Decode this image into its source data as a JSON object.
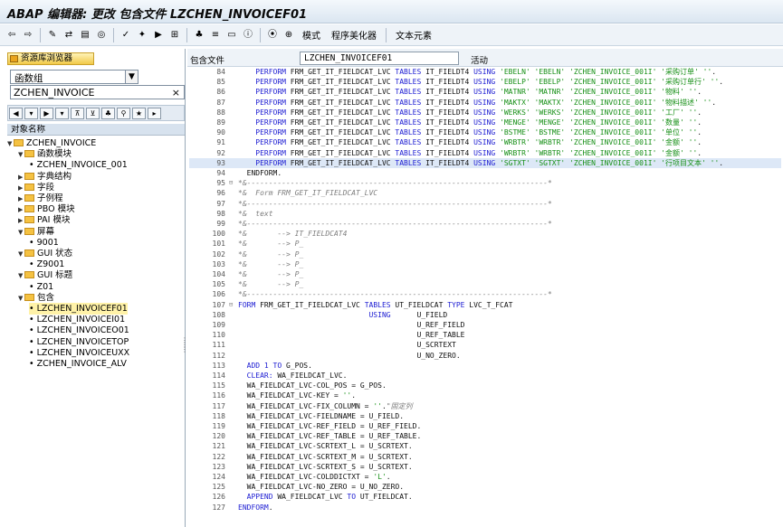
{
  "window": {
    "title": "ABAP 编辑器: 更改 包含文件 LZCHEN_INVOICEF01"
  },
  "toolbar": {
    "icons": [
      "back-icon",
      "forward-icon",
      "change-display-icon",
      "switch-icon",
      "object-list-icon",
      "display-object-icon",
      "check-icon",
      "activate-icon",
      "test-icon",
      "where-used-icon",
      "pretty-print-icon",
      "help-icon",
      "window-icon",
      "info-icon",
      "breakpoint-icon",
      "session-breakpoint-icon"
    ],
    "pattern_label": "模式",
    "pretty_printer_label": "程序美化器",
    "text_elements_label": "文本元素"
  },
  "left_panel": {
    "repo_browser_label": "资源库浏览器",
    "object_type": "函数组",
    "object_name": "ZCHEN_INVOICE",
    "object_name_header": "对象名称",
    "tree": [
      {
        "label": "ZCHEN_INVOICE",
        "level": 0,
        "type": "folder",
        "open": true
      },
      {
        "label": "函数模块",
        "level": 1,
        "type": "folder",
        "open": true
      },
      {
        "label": "ZCHEN_INVOICE_001",
        "level": 2,
        "type": "leaf"
      },
      {
        "label": "字典结构",
        "level": 1,
        "type": "folder",
        "open": false
      },
      {
        "label": "字段",
        "level": 1,
        "type": "folder",
        "open": false
      },
      {
        "label": "子例程",
        "level": 1,
        "type": "folder",
        "open": false
      },
      {
        "label": "PBO 模块",
        "level": 1,
        "type": "folder",
        "open": false
      },
      {
        "label": "PAI 模块",
        "level": 1,
        "type": "folder",
        "open": false
      },
      {
        "label": "屏幕",
        "level": 1,
        "type": "folder",
        "open": true
      },
      {
        "label": "9001",
        "level": 2,
        "type": "leaf"
      },
      {
        "label": "GUI 状态",
        "level": 1,
        "type": "folder",
        "open": true
      },
      {
        "label": "Z9001",
        "level": 2,
        "type": "leaf"
      },
      {
        "label": "GUI 标题",
        "level": 1,
        "type": "folder",
        "open": true
      },
      {
        "label": "Z01",
        "level": 2,
        "type": "leaf"
      },
      {
        "label": "包含",
        "level": 1,
        "type": "folder",
        "open": true
      },
      {
        "label": "LZCHEN_INVOICEF01",
        "level": 2,
        "type": "leaf",
        "selected": true
      },
      {
        "label": "LZCHEN_INVOICEI01",
        "level": 2,
        "type": "leaf"
      },
      {
        "label": "LZCHEN_INVOICEO01",
        "level": 2,
        "type": "leaf"
      },
      {
        "label": "LZCHEN_INVOICETOP",
        "level": 2,
        "type": "leaf"
      },
      {
        "label": "LZCHEN_INVOICEUXX",
        "level": 2,
        "type": "leaf"
      },
      {
        "label": "ZCHEN_INVOICE_ALV",
        "level": 2,
        "type": "leaf"
      }
    ]
  },
  "editor_header": {
    "include_label": "包含文件",
    "include_name": "LZCHEN_INVOICEF01",
    "status": "活动"
  },
  "code_lines": [
    {
      "n": "84",
      "m": "",
      "t": [
        [
          "kw",
          "    PERFORM "
        ],
        [
          "",
          "FRM_GET_IT_FIELDCAT_LVC "
        ],
        [
          "kw",
          "TABLES "
        ],
        [
          "",
          "IT_FIELDT4 "
        ],
        [
          "kw",
          "USING "
        ],
        [
          "st",
          "'EBELN' 'EBELN' 'ZCHEN_INVOICE_001I' '采购订单' ''"
        ],
        [
          "",
          "."
        ]
      ]
    },
    {
      "n": "85",
      "m": "",
      "t": [
        [
          "kw",
          "    PERFORM "
        ],
        [
          "",
          "FRM_GET_IT_FIELDCAT_LVC "
        ],
        [
          "kw",
          "TABLES "
        ],
        [
          "",
          "IT_FIELDT4 "
        ],
        [
          "kw",
          "USING "
        ],
        [
          "st",
          "'EBELP' 'EBELP' 'ZCHEN_INVOICE_001I' '采购订单行' ''"
        ],
        [
          "",
          "."
        ]
      ]
    },
    {
      "n": "86",
      "m": "",
      "t": [
        [
          "kw",
          "    PERFORM "
        ],
        [
          "",
          "FRM_GET_IT_FIELDCAT_LVC "
        ],
        [
          "kw",
          "TABLES "
        ],
        [
          "",
          "IT_FIELDT4 "
        ],
        [
          "kw",
          "USING "
        ],
        [
          "st",
          "'MATNR' 'MATNR' 'ZCHEN_INVOICE_001I' '物料' ''"
        ],
        [
          "",
          "."
        ]
      ]
    },
    {
      "n": "87",
      "m": "",
      "t": [
        [
          "kw",
          "    PERFORM "
        ],
        [
          "",
          "FRM_GET_IT_FIELDCAT_LVC "
        ],
        [
          "kw",
          "TABLES "
        ],
        [
          "",
          "IT_FIELDT4 "
        ],
        [
          "kw",
          "USING "
        ],
        [
          "st",
          "'MAKTX' 'MAKTX' 'ZCHEN_INVOICE_001I' '物料描述' ''"
        ],
        [
          "",
          "."
        ]
      ]
    },
    {
      "n": "88",
      "m": "",
      "t": [
        [
          "kw",
          "    PERFORM "
        ],
        [
          "",
          "FRM_GET_IT_FIELDCAT_LVC "
        ],
        [
          "kw",
          "TABLES "
        ],
        [
          "",
          "IT_FIELDT4 "
        ],
        [
          "kw",
          "USING "
        ],
        [
          "st",
          "'WERKS' 'WERKS' 'ZCHEN_INVOICE_001I' '工厂' ''"
        ],
        [
          "",
          "."
        ]
      ]
    },
    {
      "n": "89",
      "m": "",
      "t": [
        [
          "kw",
          "    PERFORM "
        ],
        [
          "",
          "FRM_GET_IT_FIELDCAT_LVC "
        ],
        [
          "kw",
          "TABLES "
        ],
        [
          "",
          "IT_FIELDT4 "
        ],
        [
          "kw",
          "USING "
        ],
        [
          "st",
          "'MENGE' 'MENGE' 'ZCHEN_INVOICE_001I' '数量' ''"
        ],
        [
          "",
          "."
        ]
      ]
    },
    {
      "n": "90",
      "m": "",
      "t": [
        [
          "kw",
          "    PERFORM "
        ],
        [
          "",
          "FRM_GET_IT_FIELDCAT_LVC "
        ],
        [
          "kw",
          "TABLES "
        ],
        [
          "",
          "IT_FIELDT4 "
        ],
        [
          "kw",
          "USING "
        ],
        [
          "st",
          "'BSTME' 'BSTME' 'ZCHEN_INVOICE_001I' '单位' ''"
        ],
        [
          "",
          "."
        ]
      ]
    },
    {
      "n": "91",
      "m": "",
      "t": [
        [
          "kw",
          "    PERFORM "
        ],
        [
          "",
          "FRM_GET_IT_FIELDCAT_LVC "
        ],
        [
          "kw",
          "TABLES "
        ],
        [
          "",
          "IT_FIELDT4 "
        ],
        [
          "kw",
          "USING "
        ],
        [
          "st",
          "'WRBTR' 'WRBTR' 'ZCHEN_INVOICE_001I' '金额' ''"
        ],
        [
          "",
          "."
        ]
      ]
    },
    {
      "n": "92",
      "m": "",
      "t": [
        [
          "kw",
          "    PERFORM "
        ],
        [
          "",
          "FRM_GET_IT_FIELDCAT_LVC "
        ],
        [
          "kw",
          "TABLES "
        ],
        [
          "",
          "IT_FIELDT4 "
        ],
        [
          "kw",
          "USING "
        ],
        [
          "st",
          "'WRBTR' 'WRBTR' 'ZCHEN_INVOICE_001I' '金额' ''"
        ],
        [
          "",
          "."
        ]
      ]
    },
    {
      "n": "93",
      "m": "",
      "hl": true,
      "t": [
        [
          "kw",
          "    PERFORM "
        ],
        [
          "",
          "FRM_GET_IT_FIELDCAT_LVC "
        ],
        [
          "kw",
          "TABLES "
        ],
        [
          "",
          "IT_FIELDT4 "
        ],
        [
          "kw",
          "USING "
        ],
        [
          "st",
          "'SGTXT' 'SGTXT' 'ZCHEN_INVOICE_001I' '行项目文本' ''"
        ],
        [
          "",
          "."
        ]
      ]
    },
    {
      "n": "94",
      "m": "",
      "t": [
        [
          "",
          "  ENDFORM."
        ]
      ]
    },
    {
      "n": "95",
      "m": "⊟",
      "t": [
        [
          "cm",
          "*&---------------------------------------------------------------------*"
        ]
      ]
    },
    {
      "n": "96",
      "m": "",
      "t": [
        [
          "cm",
          "*&  Form FRM_GET_IT_FIELDCAT_LVC"
        ]
      ]
    },
    {
      "n": "97",
      "m": "",
      "t": [
        [
          "cm",
          "*&---------------------------------------------------------------------*"
        ]
      ]
    },
    {
      "n": "98",
      "m": "",
      "t": [
        [
          "cm",
          "*&  text"
        ]
      ]
    },
    {
      "n": "99",
      "m": "",
      "t": [
        [
          "cm",
          "*&---------------------------------------------------------------------*"
        ]
      ]
    },
    {
      "n": "100",
      "m": "",
      "t": [
        [
          "cm",
          "*&       --> IT_FIELDCAT4"
        ]
      ]
    },
    {
      "n": "101",
      "m": "",
      "t": [
        [
          "cm",
          "*&       --> P_"
        ]
      ]
    },
    {
      "n": "102",
      "m": "",
      "t": [
        [
          "cm",
          "*&       --> P_"
        ]
      ]
    },
    {
      "n": "103",
      "m": "",
      "t": [
        [
          "cm",
          "*&       --> P_"
        ]
      ]
    },
    {
      "n": "104",
      "m": "",
      "t": [
        [
          "cm",
          "*&       --> P_"
        ]
      ]
    },
    {
      "n": "105",
      "m": "",
      "t": [
        [
          "cm",
          "*&       --> P_"
        ]
      ]
    },
    {
      "n": "106",
      "m": "",
      "t": [
        [
          "cm",
          "*&---------------------------------------------------------------------*"
        ]
      ]
    },
    {
      "n": "107",
      "m": "⊟",
      "t": [
        [
          "kw",
          "FORM "
        ],
        [
          "",
          "FRM_GET_IT_FIELDCAT_LVC "
        ],
        [
          "kw",
          "TABLES "
        ],
        [
          "",
          "UT_FIELDCAT "
        ],
        [
          "kw",
          "TYPE "
        ],
        [
          "",
          "LVC_T_FCAT"
        ]
      ]
    },
    {
      "n": "108",
      "m": "",
      "t": [
        [
          "kw",
          "                              USING      "
        ],
        [
          "",
          "U_FIELD"
        ]
      ]
    },
    {
      "n": "109",
      "m": "",
      "t": [
        [
          "",
          "                                         U_REF_FIELD"
        ]
      ]
    },
    {
      "n": "110",
      "m": "",
      "t": [
        [
          "",
          "                                         U_REF_TABLE"
        ]
      ]
    },
    {
      "n": "111",
      "m": "",
      "t": [
        [
          "",
          "                                         U_SCRTEXT"
        ]
      ]
    },
    {
      "n": "112",
      "m": "",
      "t": [
        [
          "",
          "                                         U_NO_ZERO."
        ]
      ]
    },
    {
      "n": "113",
      "m": "",
      "t": [
        [
          "kw",
          "  ADD "
        ],
        [
          "num-lit",
          "1 "
        ],
        [
          "kw",
          "TO "
        ],
        [
          "",
          "G_POS."
        ]
      ]
    },
    {
      "n": "114",
      "m": "",
      "t": [
        [
          "kw",
          "  CLEAR: "
        ],
        [
          "",
          "WA_FIELDCAT_LVC."
        ]
      ]
    },
    {
      "n": "115",
      "m": "",
      "t": [
        [
          "",
          "  WA_FIELDCAT_LVC-COL_POS = G_POS."
        ]
      ]
    },
    {
      "n": "116",
      "m": "",
      "t": [
        [
          "",
          "  WA_FIELDCAT_LVC-KEY = "
        ],
        [
          "st",
          "''"
        ],
        [
          "",
          "."
        ]
      ]
    },
    {
      "n": "117",
      "m": "",
      "t": [
        [
          "",
          "  WA_FIELDCAT_LVC-FIX_COLUMN = "
        ],
        [
          "st",
          "''"
        ],
        [
          "",
          "."
        ],
        [
          "cm",
          "\"固定列"
        ]
      ]
    },
    {
      "n": "118",
      "m": "",
      "t": [
        [
          "",
          "  WA_FIELDCAT_LVC-FIELDNAME = U_FIELD."
        ]
      ]
    },
    {
      "n": "119",
      "m": "",
      "t": [
        [
          "",
          "  WA_FIELDCAT_LVC-REF_FIELD = U_REF_FIELD."
        ]
      ]
    },
    {
      "n": "120",
      "m": "",
      "t": [
        [
          "",
          "  WA_FIELDCAT_LVC-REF_TABLE = U_REF_TABLE."
        ]
      ]
    },
    {
      "n": "121",
      "m": "",
      "t": [
        [
          "",
          "  WA_FIELDCAT_LVC-SCRTEXT_L = U_SCRTEXT."
        ]
      ]
    },
    {
      "n": "122",
      "m": "",
      "t": [
        [
          "",
          "  WA_FIELDCAT_LVC-SCRTEXT_M = U_SCRTEXT."
        ]
      ]
    },
    {
      "n": "123",
      "m": "",
      "t": [
        [
          "",
          "  WA_FIELDCAT_LVC-SCRTEXT_S = U_SCRTEXT."
        ]
      ]
    },
    {
      "n": "124",
      "m": "",
      "t": [
        [
          "",
          "  WA_FIELDCAT_LVC-COLDDICTXT = "
        ],
        [
          "st",
          "'L'"
        ],
        [
          "",
          "."
        ]
      ]
    },
    {
      "n": "125",
      "m": "",
      "t": [
        [
          "",
          "  WA_FIELDCAT_LVC-NO_ZERO = U_NO_ZERO."
        ]
      ]
    },
    {
      "n": "126",
      "m": "",
      "t": [
        [
          "kw",
          "  APPEND "
        ],
        [
          "",
          "WA_FIELDCAT_LVC "
        ],
        [
          "kw",
          "TO "
        ],
        [
          "",
          "UT_FIELDCAT."
        ]
      ]
    },
    {
      "n": "127",
      "m": "",
      "t": [
        [
          "kw",
          "ENDFORM"
        ],
        [
          "",
          "."
        ]
      ]
    }
  ]
}
